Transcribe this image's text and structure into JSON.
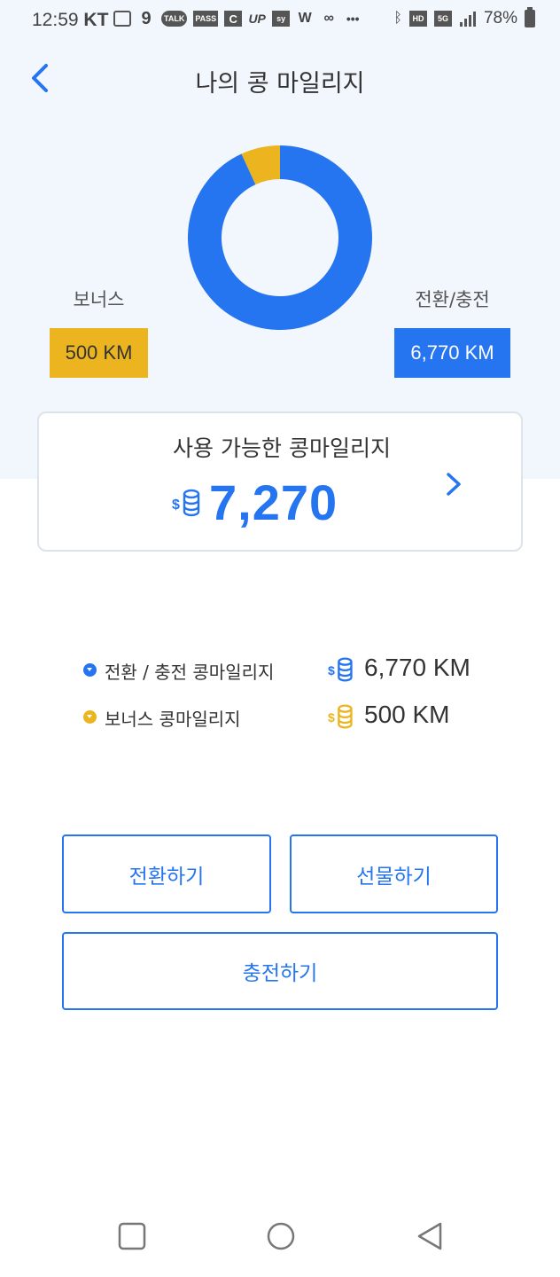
{
  "status_bar": {
    "time": "12:59",
    "carrier": "KT",
    "battery": "78%",
    "icons_left": [
      "chat-icon",
      "g-icon",
      "talk-icon",
      "pass-icon",
      "c-icon",
      "up-icon",
      "sy-icon",
      "w-icon",
      "link-icon",
      "more-icon"
    ],
    "labels": {
      "talk": "TALK",
      "pass": "PASS",
      "up": "UP",
      "sy": "sy",
      "w": "W",
      "hd": "HD",
      "fiveg": "5G",
      "more": "•••"
    }
  },
  "header": {
    "title": "나의 콩 마일리지"
  },
  "chart_data": {
    "type": "pie",
    "donut": true,
    "categories": [
      "보너스",
      "전환/충전"
    ],
    "values": [
      500,
      6770
    ],
    "colors": [
      "#ecb51f",
      "#2574f0"
    ]
  },
  "legend": {
    "bonus": {
      "label": "보너스",
      "value": "500 KM"
    },
    "charge": {
      "label": "전환/충전",
      "value": "6,770 KM"
    }
  },
  "available": {
    "title": "사용 가능한 콩마일리지",
    "amount": "7,270"
  },
  "breakdown": [
    {
      "label": "전환 / 충전 콩마일리지",
      "value": "6,770 KM",
      "color": "#2574f0"
    },
    {
      "label": "보너스 콩마일리지",
      "value": "500 KM",
      "color": "#ecb51f"
    }
  ],
  "buttons": {
    "convert": "전환하기",
    "gift": "선물하기",
    "charge": "충전하기"
  },
  "colors": {
    "accent": "#2574f0",
    "bonus": "#ecb51f",
    "background_top": "#f2f6fd"
  }
}
